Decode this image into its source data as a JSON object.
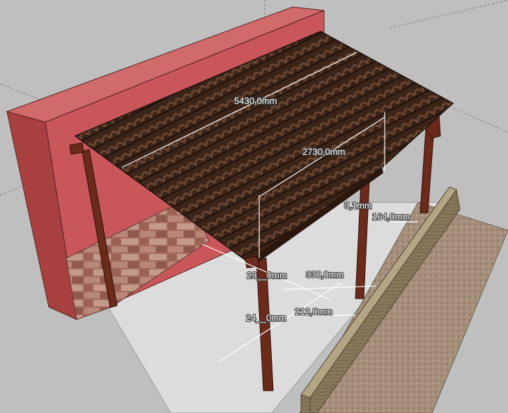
{
  "viewport": {
    "background": "#bfbfbf",
    "dimensions": [
      {
        "id": "roof-length",
        "text": "5430,0mm"
      },
      {
        "id": "roof-depth",
        "text": "2730,0mm"
      },
      {
        "id": "post-offset",
        "text": "3,1mm"
      },
      {
        "id": "wall-gap",
        "text": "164,0mm"
      },
      {
        "id": "post-height",
        "text": "29__0mm"
      },
      {
        "id": "post-spacing",
        "text": "330,0mm"
      },
      {
        "id": "curb-offset",
        "text": "212,0mm"
      },
      {
        "id": "floor-width",
        "text": "24__0mm"
      }
    ]
  },
  "colors": {
    "wall_face": "#c9575a",
    "wall_side": "#a8403f",
    "wall_top": "#d06a6b",
    "roof": "#3b2418",
    "roof_highlight": "#6a4530",
    "post": "#6b2a1a",
    "floor": "#dcdcdc",
    "gravel": "#a58f7a",
    "stone": "#8a7a5c"
  }
}
